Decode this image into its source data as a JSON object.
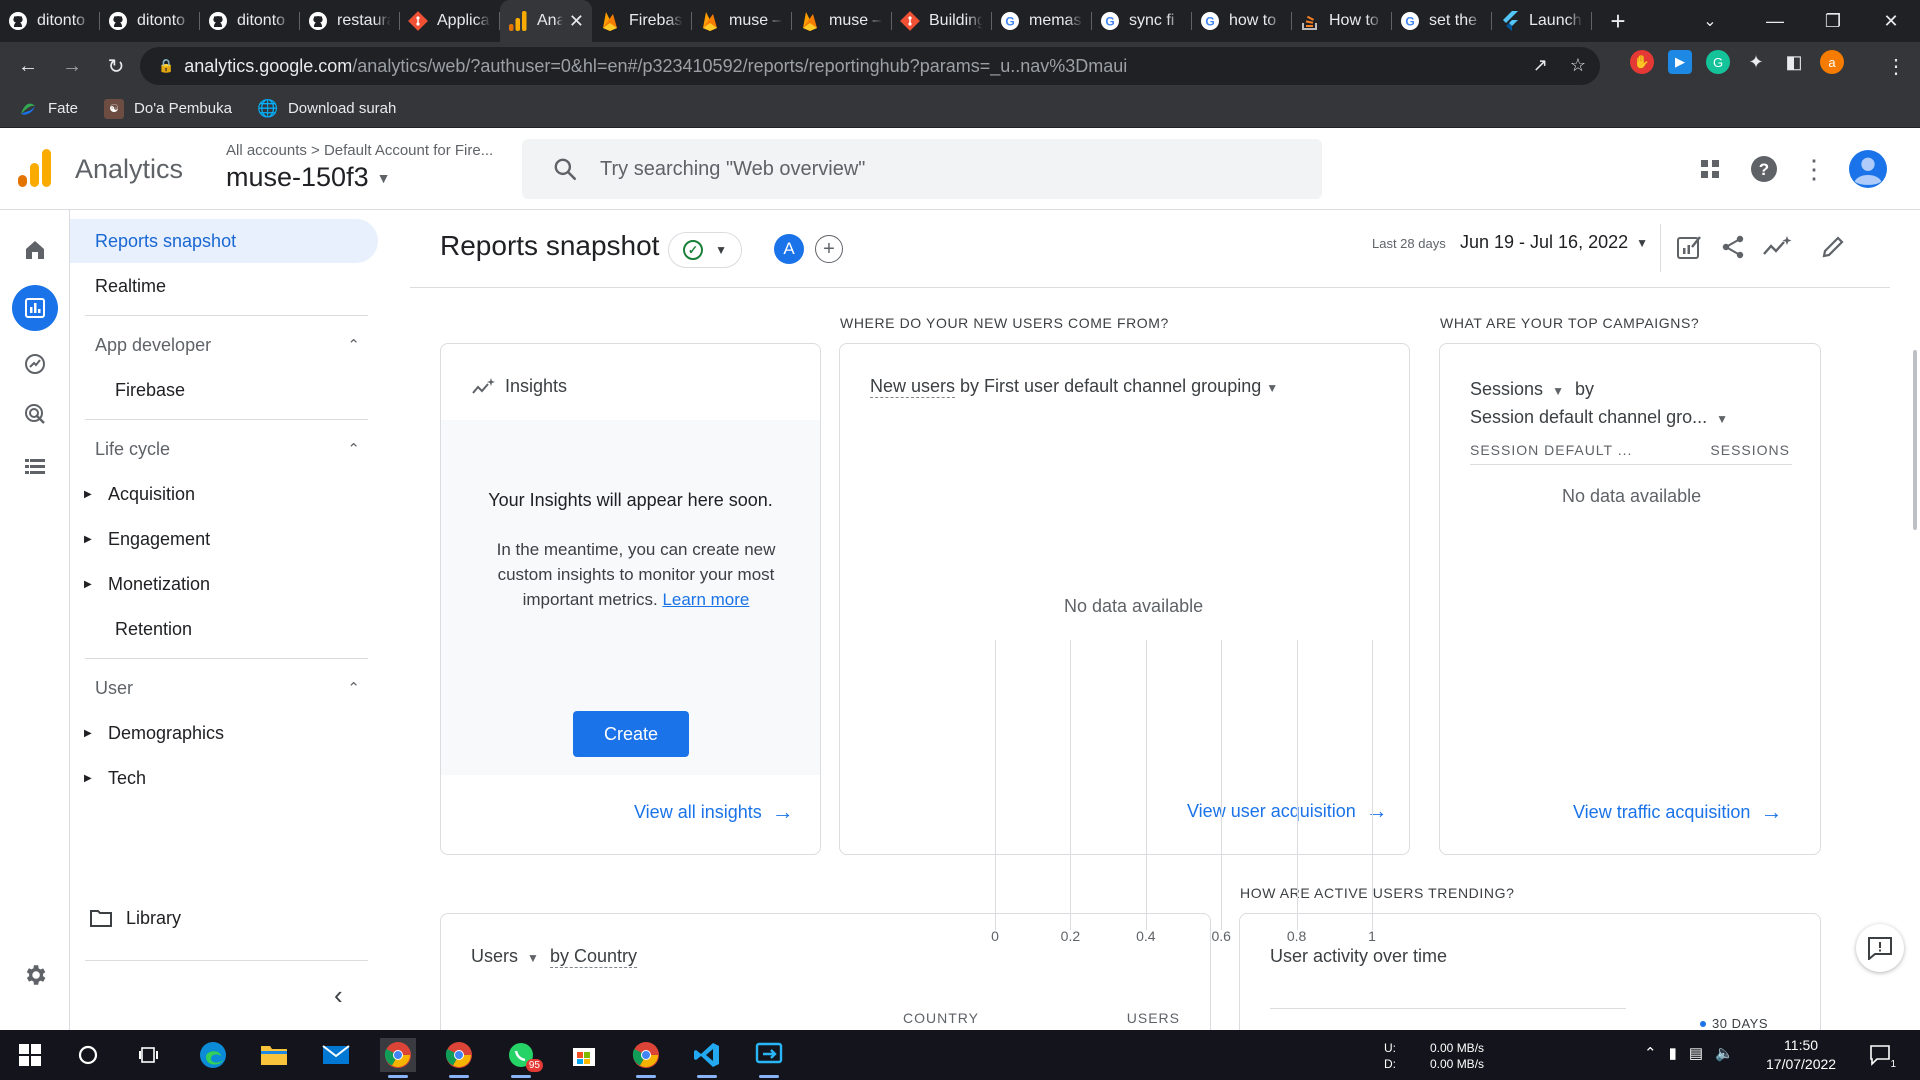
{
  "browser": {
    "tabs": [
      {
        "label": "ditonto",
        "icon": "github-icon",
        "color": "#ffffff"
      },
      {
        "label": "ditonto",
        "icon": "github-icon",
        "color": "#ffffff"
      },
      {
        "label": "ditonto",
        "icon": "github-icon",
        "color": "#ffffff"
      },
      {
        "label": "restaurant",
        "icon": "github-icon",
        "color": "#ffffff"
      },
      {
        "label": "Application",
        "icon": "git-icon",
        "color": "#f05033"
      },
      {
        "label": "Analytics",
        "icon": "analytics-icon",
        "color": "#f9ab00",
        "active": true
      },
      {
        "label": "Firebase",
        "icon": "firebase-icon",
        "color": "#ffa000"
      },
      {
        "label": "muse –",
        "icon": "firebase-icon",
        "color": "#ffa000"
      },
      {
        "label": "muse –",
        "icon": "firebase-icon",
        "color": "#ffa000"
      },
      {
        "label": "Building",
        "icon": "git-icon",
        "color": "#f05033"
      },
      {
        "label": "memas",
        "icon": "google-icon",
        "color": "#ffffff"
      },
      {
        "label": "sync fi",
        "icon": "google-icon",
        "color": "#ffffff"
      },
      {
        "label": "how to",
        "icon": "google-icon",
        "color": "#ffffff"
      },
      {
        "label": "How to",
        "icon": "stackoverflow-icon",
        "color": "#f48024"
      },
      {
        "label": "set the",
        "icon": "google-icon",
        "color": "#ffffff"
      },
      {
        "label": "Launch",
        "icon": "flutter-icon",
        "color": "#54c5f8"
      }
    ],
    "url_host": "analytics.google.com",
    "url_path": "/analytics/web/?authuser=0&hl=en#/p323410592/reports/reportinghub?params=_u..nav%3Dmaui",
    "profile_initial": "a",
    "bookmarks": [
      {
        "label": "Fate",
        "icon": "bookmark-fate-icon"
      },
      {
        "label": "Do'a Pembuka",
        "icon": "bookmark-doa-icon"
      },
      {
        "label": "Download surah",
        "icon": "globe-icon"
      }
    ]
  },
  "ga": {
    "app_title": "Analytics",
    "breadcrumb": "All accounts  >  Default Account for Fire...",
    "property": "muse-150f3",
    "search_placeholder": "Try searching \"Web overview\""
  },
  "drawer": {
    "reports_snapshot": "Reports snapshot",
    "realtime": "Realtime",
    "sections": [
      {
        "title": "App developer",
        "items": [
          {
            "label": "Firebase",
            "expandable": false
          }
        ]
      },
      {
        "title": "Life cycle",
        "items": [
          {
            "label": "Acquisition",
            "expandable": true
          },
          {
            "label": "Engagement",
            "expandable": true
          },
          {
            "label": "Monetization",
            "expandable": true
          },
          {
            "label": "Retention",
            "expandable": false
          }
        ]
      },
      {
        "title": "User",
        "items": [
          {
            "label": "Demographics",
            "expandable": true
          },
          {
            "label": "Tech",
            "expandable": true
          }
        ]
      }
    ],
    "library": "Library"
  },
  "main": {
    "title": "Reports snapshot",
    "comparison_avatar": "A",
    "date_label": "Last 28 days",
    "date_range": "Jun 19 - Jul 16, 2022",
    "insights": {
      "title": "Insights",
      "heading": "Your Insights will appear here soon.",
      "text": "In the meantime, you can create new custom insights to monitor your most important metrics.",
      "learn_more": "Learn more",
      "create": "Create",
      "link": "View all insights"
    },
    "new_users": {
      "question": "WHERE DO YOUR NEW USERS COME FROM?",
      "metric": "New users",
      "dimension": "by First user default channel grouping",
      "no_data": "No data available",
      "ticks": [
        "0",
        "0.2",
        "0.4",
        "0.6",
        "0.8",
        "1"
      ],
      "link": "View user acquisition"
    },
    "campaigns": {
      "question": "WHAT ARE YOUR TOP CAMPAIGNS?",
      "metric": "Sessions",
      "by": "by",
      "dimension": "Session default channel gro...",
      "col1": "SESSION DEFAULT ...",
      "col2": "SESSIONS",
      "no_data": "No data available",
      "link": "View traffic acquisition"
    },
    "country": {
      "metric": "Users",
      "dimension": "by Country",
      "col1": "COUNTRY",
      "col2": "USERS"
    },
    "activity": {
      "question": "HOW ARE ACTIVE USERS TRENDING?",
      "title": "User activity over time",
      "legend": "30 DAYS"
    }
  },
  "taskbar": {
    "whatsapp_badge": "95",
    "net_up_label": "U:",
    "net_down_label": "D:",
    "net_up": "0.00 MB/s",
    "net_down": "0.00 MB/s",
    "time": "11:50",
    "date": "17/07/2022",
    "notif_count": "1"
  }
}
